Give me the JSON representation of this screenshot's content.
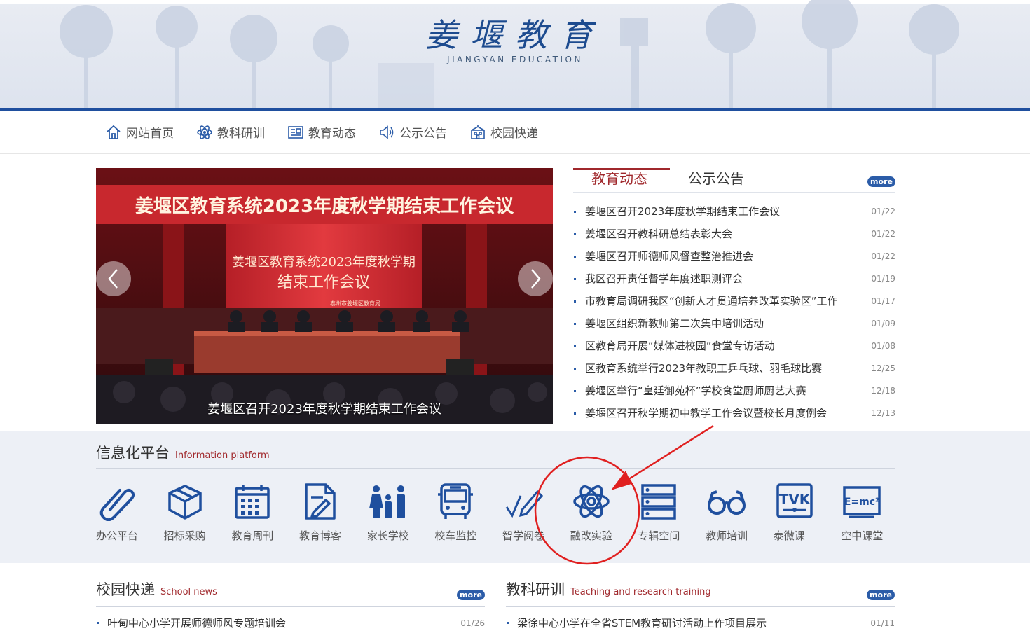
{
  "header": {
    "logo_text": "姜堰教育",
    "logo_subtitle": "JIANGYAN EDUCATION"
  },
  "nav": {
    "items": [
      {
        "label": "网站首页",
        "icon": "home-icon"
      },
      {
        "label": "教科研训",
        "icon": "atom-icon"
      },
      {
        "label": "教育动态",
        "icon": "newspaper-icon"
      },
      {
        "label": "公示公告",
        "icon": "speaker-icon"
      },
      {
        "label": "校园快递",
        "icon": "school-building-icon"
      }
    ]
  },
  "slideshow": {
    "banner_text": "姜堰区教育系统2023年度秋学期结束工作会议",
    "screen_line1": "姜堰区教育系统2023年度秋学期",
    "screen_line2": "结束工作会议",
    "screen_small": "泰州市姜堰区教育局",
    "caption": "姜堰区召开2023年度秋学期结束工作会议"
  },
  "news": {
    "tab_active": "教育动态",
    "tab_other": "公示公告",
    "more_label": "more",
    "items": [
      {
        "title": "姜堰区召开2023年度秋学期结束工作会议",
        "date": "01/22"
      },
      {
        "title": "姜堰区召开教科研总结表彰大会",
        "date": "01/22"
      },
      {
        "title": "姜堰区召开师德师风督查整治推进会",
        "date": "01/22"
      },
      {
        "title": "我区召开责任督学年度述职测评会",
        "date": "01/19"
      },
      {
        "title": "市教育局调研我区“创新人才贯通培养改革实验区”工作",
        "date": "01/17"
      },
      {
        "title": "姜堰区组织新教师第二次集中培训活动",
        "date": "01/09"
      },
      {
        "title": "区教育局开展“媒体进校园”食堂专访活动",
        "date": "01/08"
      },
      {
        "title": "区教育系统举行2023年教职工乒乓球、羽毛球比赛",
        "date": "12/25"
      },
      {
        "title": "姜堰区举行“皇廷御苑杯”学校食堂厨师厨艺大赛",
        "date": "12/18"
      },
      {
        "title": "姜堰区召开秋学期初中教学工作会议暨校长月度例会",
        "date": "12/13"
      }
    ]
  },
  "platform": {
    "title": "信息化平台",
    "title_en": "Information platform",
    "items": [
      {
        "label": "办公平台",
        "icon": "paperclip-icon"
      },
      {
        "label": "招标采购",
        "icon": "box-icon"
      },
      {
        "label": "教育周刊",
        "icon": "calendar-icon"
      },
      {
        "label": "教育博客",
        "icon": "document-pen-icon"
      },
      {
        "label": "家长学校",
        "icon": "family-icon"
      },
      {
        "label": "校车监控",
        "icon": "bus-icon"
      },
      {
        "label": "智学阅卷",
        "icon": "check-pen-icon"
      },
      {
        "label": "融改实验",
        "icon": "atom-icon"
      },
      {
        "label": "专辑空间",
        "icon": "server-icon"
      },
      {
        "label": "教师培训",
        "icon": "glasses-icon"
      },
      {
        "label": "泰微课",
        "icon": "tvk-logo-icon",
        "logo_text": "TVK"
      },
      {
        "label": "空中课堂",
        "icon": "blackboard-icon",
        "board_text": "E=mc²"
      }
    ]
  },
  "campus": {
    "title": "校园快递",
    "title_en": "School news",
    "more_label": "more",
    "items": [
      {
        "title": "叶甸中心小学开展师德师风专题培训会",
        "date": "01/26"
      }
    ]
  },
  "research": {
    "title": "教科研训",
    "title_en": "Teaching and research training",
    "more_label": "more",
    "items": [
      {
        "title": "梁徐中心小学在全省STEM教育研讨活动上作项目展示",
        "date": "01/11"
      }
    ]
  },
  "colors": {
    "brand_blue": "#1f4f9e",
    "accent_red": "#a0282c",
    "annotation_red": "#e02020"
  }
}
